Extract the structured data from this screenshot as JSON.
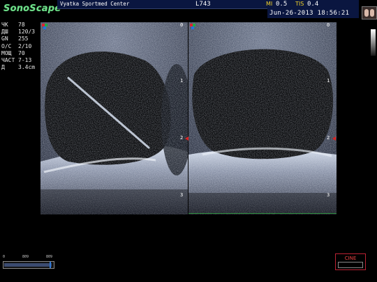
{
  "header": {
    "brand": "SonoScape",
    "center_name": "Vyatka Sportmed Center",
    "probe": "L743",
    "mi_label": "MI",
    "mi_value": "0.5",
    "tis_label": "TIS",
    "tis_value": "0.4",
    "datetime": "Jun-26-2013 18:56:21",
    "corner_icon": "organ-preset-icon"
  },
  "params": [
    {
      "key": "ЧК",
      "value": "78"
    },
    {
      "key": "ДШ",
      "value": "120/3"
    },
    {
      "key": "GN",
      "value": "255"
    },
    {
      "key": "О/С",
      "value": "2/10"
    },
    {
      "key": "МОЩ",
      "value": "70"
    },
    {
      "key": "ЧАСТ",
      "value": "7-13"
    },
    {
      "key": "Д",
      "value": "3.4cm"
    }
  ],
  "depth_scale": {
    "left_marks": [
      "0",
      "1",
      "2",
      "3"
    ],
    "right_marks": [
      "0",
      "1",
      "2",
      "3"
    ]
  },
  "cine": {
    "scale_labels": [
      "0",
      "809",
      "809"
    ],
    "position_fraction": 0.97,
    "button_label": "CINE"
  },
  "colors": {
    "brand": "#6fe08a",
    "header_bar": "#0a1640",
    "index_label": "#f2d22a",
    "focus_marker": "#d22222",
    "cine_button": "#e44444"
  }
}
